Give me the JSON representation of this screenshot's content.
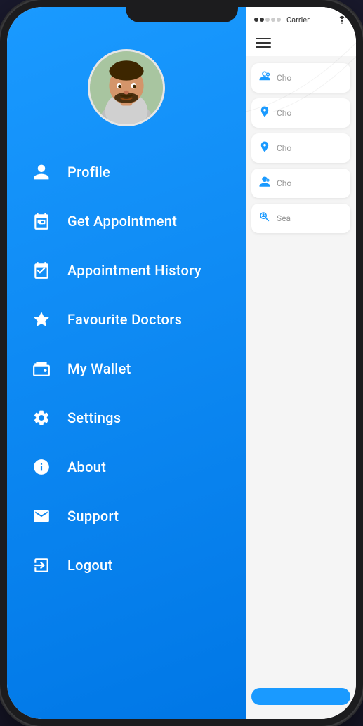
{
  "phone": {
    "status_bar": {
      "signal": "●●○○○",
      "carrier": "Carrier",
      "wifi": "WiFi"
    }
  },
  "sidebar": {
    "menu_items": [
      {
        "id": "profile",
        "label": "Profile",
        "icon": "person"
      },
      {
        "id": "get-appointment",
        "label": "Get Appointment",
        "icon": "calendar"
      },
      {
        "id": "appointment-history",
        "label": "Appointment History",
        "icon": "calendar-check"
      },
      {
        "id": "favourite-doctors",
        "label": "Favourite Doctors",
        "icon": "star"
      },
      {
        "id": "my-wallet",
        "label": "My Wallet",
        "icon": "wallet"
      },
      {
        "id": "settings",
        "label": "Settings",
        "icon": "gear"
      },
      {
        "id": "about",
        "label": "About",
        "icon": "info"
      },
      {
        "id": "support",
        "label": "Support",
        "icon": "envelope"
      },
      {
        "id": "logout",
        "label": "Logout",
        "icon": "logout"
      }
    ]
  },
  "right_panel": {
    "rows": [
      {
        "icon": "doctor",
        "text": "Cho"
      },
      {
        "icon": "location",
        "text": "Cho"
      },
      {
        "icon": "location",
        "text": "Cho"
      },
      {
        "icon": "doctor2",
        "text": "Cho"
      },
      {
        "icon": "search-person",
        "text": "Sea"
      }
    ],
    "button_label": ""
  }
}
